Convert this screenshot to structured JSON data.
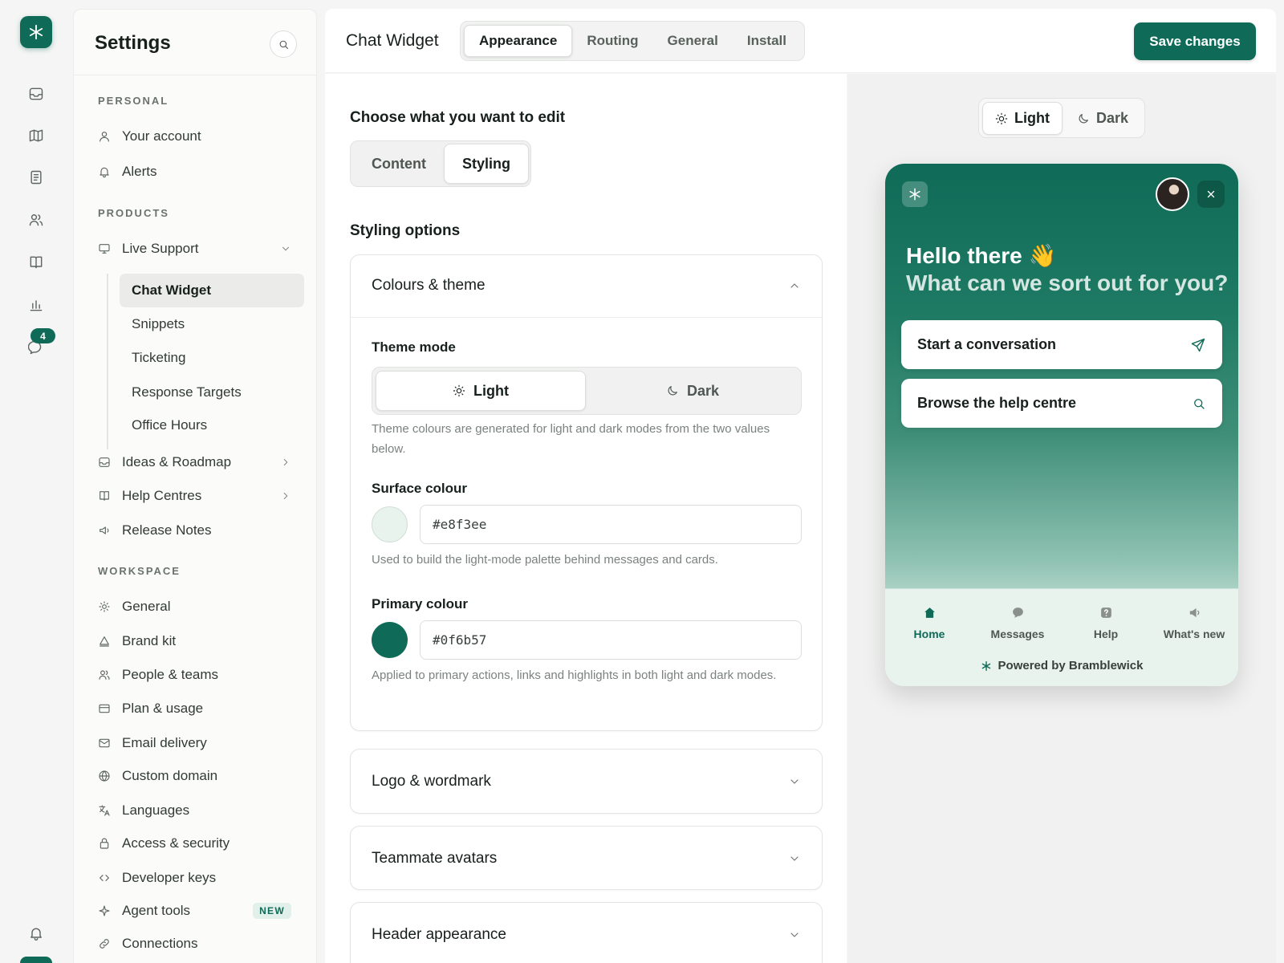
{
  "colors": {
    "brand": "#0f6b57",
    "surface": "#e8f3ee"
  },
  "rail": {
    "badge_count": "4"
  },
  "settings": {
    "title": "Settings",
    "sections": {
      "personal": "PERSONAL",
      "products": "PRODUCTS",
      "workspace": "WORKSPACE"
    },
    "personal_items": [
      "Your account",
      "Alerts"
    ],
    "products_items": {
      "live_support": "Live Support",
      "live_support_children": [
        "Chat Widget",
        "Snippets",
        "Ticketing",
        "Response Targets",
        "Office Hours"
      ],
      "ideas": "Ideas & Roadmap",
      "help_centres": "Help Centres",
      "release_notes": "Release Notes"
    },
    "workspace_items": [
      "General",
      "Brand kit",
      "People & teams",
      "Plan & usage",
      "Email delivery",
      "Custom domain",
      "Languages",
      "Access & security",
      "Developer keys",
      "Agent tools",
      "Connections"
    ],
    "new_badge": "NEW"
  },
  "topbar": {
    "title": "Chat Widget",
    "tabs": [
      "Appearance",
      "Routing",
      "General",
      "Install"
    ],
    "save_label": "Save changes"
  },
  "editor": {
    "choose_heading": "Choose what you want to edit",
    "edit_tabs": [
      "Content",
      "Styling"
    ],
    "styling_heading": "Styling options",
    "colours_card": {
      "title": "Colours & theme",
      "theme_mode_label": "Theme mode",
      "theme_options": [
        "Light",
        "Dark"
      ],
      "theme_help": "Theme colours are generated for light and dark modes from the two values below.",
      "surface_label": "Surface colour",
      "surface_value": "#e8f3ee",
      "surface_help": "Used to build the light-mode palette behind messages and cards.",
      "primary_label": "Primary colour",
      "primary_value": "#0f6b57",
      "primary_help": "Applied to primary actions, links and highlights in both light and dark modes."
    },
    "collapsed_cards": [
      "Logo & wordmark",
      "Teammate avatars",
      "Header appearance"
    ]
  },
  "preview": {
    "mode_options": [
      "Light",
      "Dark"
    ],
    "greeting_line1": "Hello there 👋",
    "greeting_line2": "What can we sort out for you?",
    "start_conversation": "Start a conversation",
    "browse_help": "Browse the help centre",
    "nav": [
      "Home",
      "Messages",
      "Help",
      "What's new"
    ],
    "powered_by": "Powered by Bramblewick"
  }
}
